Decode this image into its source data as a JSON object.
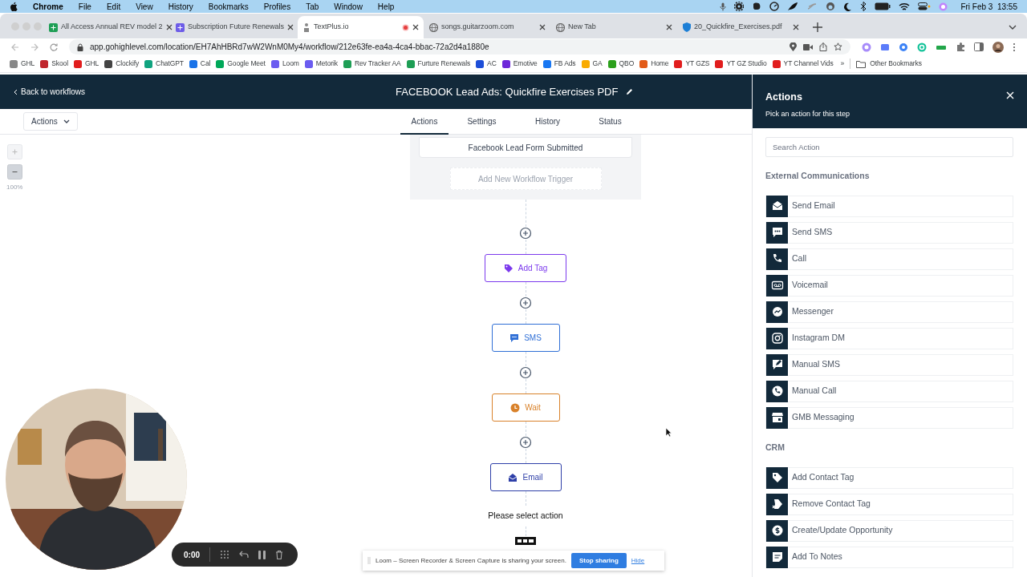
{
  "menubar": {
    "app": "Chrome",
    "menus": [
      "File",
      "Edit",
      "View",
      "History",
      "Bookmarks",
      "Profiles",
      "Tab",
      "Window",
      "Help"
    ],
    "clock": "Fri Feb 3  13:55"
  },
  "browser": {
    "tabs": [
      {
        "title": "All Access Annual REV model 2",
        "selected": false
      },
      {
        "title": "Subscription Future Renewals",
        "selected": false
      },
      {
        "title": "TextPlus.io",
        "selected": true
      },
      {
        "title": "songs.guitarzoom.com",
        "selected": false
      },
      {
        "title": "New Tab",
        "selected": false
      },
      {
        "title": "20_Quickfire_Exercises.pdf",
        "selected": false
      }
    ],
    "address": "app.gohighlevel.com/location/EH7AhHBRd7wW2WnM0My4/workflow/212e63fe-ea4a-4ca4-bbac-72a2d4a1880e",
    "bookmarks": [
      "GHL",
      "Skool",
      "GHL",
      "Clockify",
      "ChatGPT",
      "Cal",
      "Google Meet",
      "Loom",
      "Metorik",
      "Rev Tracker AA",
      "Furture Renewals",
      "AC",
      "Emotive",
      "FB Ads",
      "GA",
      "QBO",
      "Home",
      "YT GZS",
      "YT GZ Studio",
      "YT Channel Vids"
    ],
    "overflow": "»",
    "other_bookmarks": "Other Bookmarks"
  },
  "header": {
    "back": "Back to workflows",
    "title": "FACEBOOK Lead Ads: Quickfire Exercises PDF"
  },
  "toolbar": {
    "actions_menu": "Actions",
    "tabs": [
      {
        "label": "Actions",
        "selected": true
      },
      {
        "label": "Settings",
        "selected": false
      },
      {
        "label": "History",
        "selected": false
      },
      {
        "label": "Status",
        "selected": false
      }
    ]
  },
  "canvas": {
    "zoom": "100%",
    "trigger": "Facebook Lead Form Submitted",
    "add_trigger": "Add New Workflow Trigger",
    "steps": [
      {
        "kind": "action",
        "label": "Add Tag",
        "color": "#7c3aed"
      },
      {
        "kind": "action",
        "label": "SMS",
        "color": "#2f6fd6"
      },
      {
        "kind": "action",
        "label": "Wait",
        "color": "#d9822b"
      },
      {
        "kind": "action",
        "label": "Email",
        "color": "#2e3fa8"
      },
      {
        "kind": "placeholder",
        "label": "Please select action"
      }
    ]
  },
  "panel": {
    "title": "Actions",
    "subtitle": "Pick an action for this step",
    "search_placeholder": "Search Action",
    "sections": [
      {
        "title": "External Communications",
        "items": [
          "Send Email",
          "Send SMS",
          "Call",
          "Voicemail",
          "Messenger",
          "Instagram DM",
          "Manual SMS",
          "Manual Call",
          "GMB Messaging"
        ]
      },
      {
        "title": "CRM",
        "items": [
          "Add Contact Tag",
          "Remove Contact Tag",
          "Create/Update Opportunity",
          "Add To Notes"
        ]
      }
    ]
  },
  "recorder": {
    "timer": "0:00"
  },
  "share_bar": {
    "message": "Loom – Screen Recorder & Screen Capture is sharing your screen.",
    "stop": "Stop sharing",
    "hide": "Hide"
  }
}
